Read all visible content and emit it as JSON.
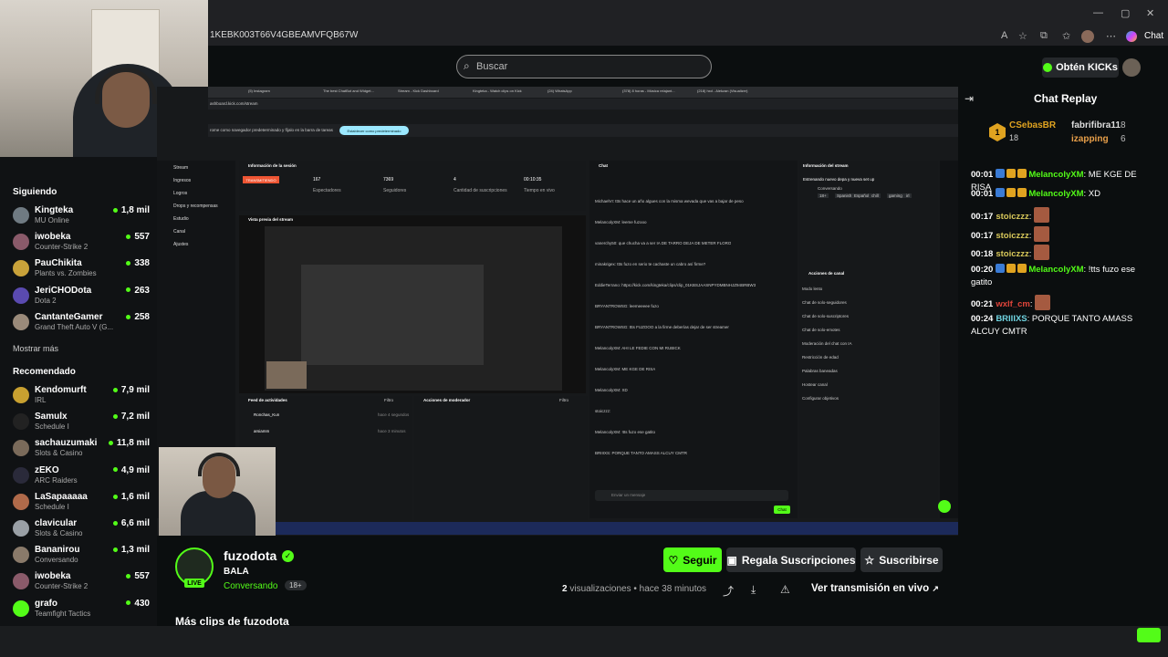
{
  "browser": {
    "url": "1KEBK003T66V4GBEAMVFQB67W",
    "right_label": "Chat"
  },
  "header": {
    "search_placeholder": "Buscar",
    "kicks_button": "Obtén KICKs"
  },
  "sidebar": {
    "following_title": "Siguiendo",
    "following": [
      {
        "name": "Kingteka",
        "game": "MU Online",
        "viewers": "1,8 mil",
        "color": "#6f7a82"
      },
      {
        "name": "iwobeka",
        "game": "Counter-Strike 2",
        "viewers": "557",
        "color": "#8a5a6a"
      },
      {
        "name": "PauChikita",
        "game": "Plants vs. Zombies",
        "viewers": "338",
        "color": "#c9a23a"
      },
      {
        "name": "JeriCHODota",
        "game": "Dota 2",
        "viewers": "263",
        "color": "#5a4ab0"
      },
      {
        "name": "CantanteGamer",
        "game": "Grand Theft Auto V (G...",
        "viewers": "258",
        "color": "#9a8a7a"
      }
    ],
    "show_more": "Mostrar más",
    "recommended_title": "Recomendado",
    "recommended": [
      {
        "name": "Kendomurft",
        "game": "IRL",
        "viewers": "7,9 mil",
        "color": "#c8a030"
      },
      {
        "name": "Samulx",
        "game": "Schedule I",
        "viewers": "7,2 mil",
        "color": "#222"
      },
      {
        "name": "sachauzumaki",
        "game": "Slots & Casino",
        "viewers": "11,8 mil",
        "color": "#7a6a5a"
      },
      {
        "name": "zEKO",
        "game": "ARC Raiders",
        "viewers": "4,9 mil",
        "color": "#2a2a3a"
      },
      {
        "name": "LaSapaaaaa",
        "game": "Schedule I",
        "viewers": "1,6 mil",
        "color": "#b06a4a"
      },
      {
        "name": "clavicular",
        "game": "Slots & Casino",
        "viewers": "6,6 mil",
        "color": "#9aa0a6"
      },
      {
        "name": "Bananirou",
        "game": "Conversando",
        "viewers": "1,3 mil",
        "color": "#8a7a6a"
      },
      {
        "name": "iwobeka",
        "game": "Counter-Strike 2",
        "viewers": "557",
        "color": "#8a5a6a"
      },
      {
        "name": "grafo",
        "game": "Teamfight Tactics",
        "viewers": "430",
        "color": "#53fc18"
      }
    ]
  },
  "inner": {
    "tabs": [
      "(5) Instagram",
      "The best ChatBot and Widget...",
      "Stream - Kick Dashboard",
      "Kingteka - Watch clips on Kick",
      "(24) WhatsApp",
      "(378) 8 horas - Música relajant...",
      "(218) hxd - Alekzan (Visualizer)"
    ],
    "establish": "Establecer como predeterminado",
    "info_text": "rome como navegador predeterminado y fíjalo en la barra de tareas",
    "nav": [
      "Stream",
      "Ingresos",
      "Logros",
      "Drops y recompensas",
      "Estudio",
      "Canal",
      "Ajustes"
    ],
    "session_title": "Información de la sesión",
    "status": "TRANSMITIENDO",
    "stats": [
      {
        "v": "167",
        "l": "Espectadores"
      },
      {
        "v": "7369",
        "l": "Seguidores"
      },
      {
        "v": "4",
        "l": "Cantidad de suscripciones"
      },
      {
        "v": "00:10:35",
        "l": "Tiempo en vivo"
      }
    ],
    "preview_title": "Vista previa del stream",
    "feed_title": "Feed de actividades",
    "filter": "Filtro",
    "mod_title": "Acciones de moderador",
    "feed": [
      {
        "n": "Ronchas_Kun",
        "t": "hace 4 segundos"
      },
      {
        "n": "arsiamm",
        "t": "hace 3 minutos"
      }
    ],
    "chat_title": "Chat",
    "chat_lines": [
      "MichaelVI: ttts hace un año algues con la misma wevada que vas a bajar de peso",
      "MelancolyXM: leeme fuzooo",
      "vanerchy50: que chucha va a ser IA DE TARRO DEJA DE METER FLORO",
      "minakrigex: ttts fuzo en serio te cachaste un cabro así firme?",
      "EddieTerrano: https://kick.com/kingteka/clips/clip_01KBSJAASNPYDMBNHJZ94BRBW3",
      "BRYANTROWSG: leemeeeee fuzo",
      "BRYANTROWSG: ttts FUZOOO a la firme deberías dejar de ser streamer",
      "MelancolyXM: AHI LE FEDIE CON MI RUBICK",
      "MelancolyXM: ME KGE DE RISA",
      "MelancolyXM: XD",
      "stoiczzz:",
      "MelancolyXM: !tts fuzo ese gatito",
      "BRIIIXS: PORQUE TANTO AMASS ALCUY CMTR"
    ],
    "chat_placeholder": "Enviar un mensaje",
    "chat_send": "Chat",
    "info_panel_title": "Información del stream",
    "info_panel_text": "Estrenando nuevo depa y nueva set up",
    "info_panel_cat": "Conversando",
    "tags": [
      "18+",
      "Spanish",
      "Español",
      "chill",
      "gaming",
      "irl"
    ],
    "mod_actions_title": "Acciones de canal",
    "mod_actions": [
      "Modo lento",
      "Chat de solo-seguidores",
      "Chat de solo-suscriptores",
      "Chat de solo-emotes",
      "Moderación del chat con IA",
      "Restricción de edad",
      "Palabras baneadas",
      "Hostear canal",
      "Configurar objetivos"
    ]
  },
  "channel": {
    "name": "fuzodota",
    "clip_title": "BALA",
    "category": "Conversando",
    "age": "18+",
    "live": "LIVE"
  },
  "actions": {
    "follow": "Seguir",
    "gift": "Regala Suscripciones",
    "subscribe": "Suscribirse",
    "views_count": "2",
    "views_label": "visualizaciones",
    "time": "• hace 38 minutos",
    "watch_live": "Ver transmisión en vivo"
  },
  "more_clips": "Más clips de fuzodota",
  "replay": {
    "title": "Chat Replay",
    "top": [
      {
        "name": "CSebasBR",
        "count": "18",
        "rank": "1"
      },
      {
        "name": "fabrifibra11",
        "count": "8"
      },
      {
        "name": "izapping",
        "count": "6"
      }
    ],
    "messages": [
      {
        "time": "00:01",
        "user": "MelancolyXM",
        "color": "#53fc18",
        "text": ": ME KGE DE RISA",
        "badges": 3
      },
      {
        "time": "00:01",
        "user": "MelancolyXM",
        "color": "#53fc18",
        "text": ": XD",
        "badges": 3
      },
      {
        "time": "00:17",
        "user": "stoiczzz",
        "color": "#d8c85a",
        "text": ":",
        "emote": true
      },
      {
        "time": "00:17",
        "user": "stoiczzz",
        "color": "#d8c85a",
        "text": ":",
        "emote": true
      },
      {
        "time": "00:18",
        "user": "stoiczzz",
        "color": "#d8c85a",
        "text": ":",
        "emote": true
      },
      {
        "time": "00:20",
        "user": "MelancolyXM",
        "color": "#53fc18",
        "text": ": !tts fuzo ese gatito",
        "badges": 3
      },
      {
        "time": "00:21",
        "user": "wxlf_cm",
        "color": "#e0443a",
        "text": ":",
        "emote": true
      },
      {
        "time": "00:24",
        "user": "BRIIIXS",
        "color": "#6fd3e0",
        "text": ": PORQUE TANTO AMASS ALCUY CMTR"
      }
    ]
  },
  "colors": {
    "accent": "#53fc18",
    "bg": "#0b0e0f"
  }
}
